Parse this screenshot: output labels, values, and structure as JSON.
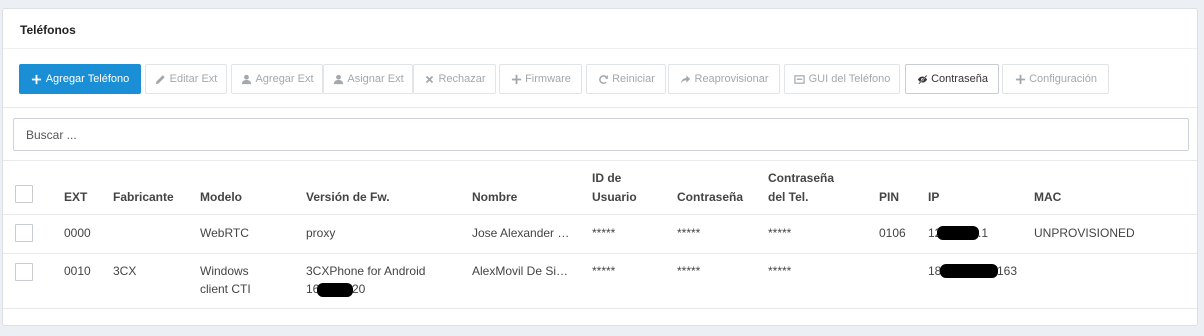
{
  "panel": {
    "title": "Teléfonos"
  },
  "toolbar": {
    "buttons": [
      {
        "label": "Agregar Teléfono",
        "icon": "plus-icon"
      },
      {
        "label": "Editar Ext",
        "icon": "pencil-icon"
      },
      {
        "label": "Agregar Ext",
        "icon": "user-icon"
      },
      {
        "label": "Asignar Ext",
        "icon": "user-icon"
      },
      {
        "label": "Rechazar",
        "icon": "x-icon"
      },
      {
        "label": "Firmware",
        "icon": "plus-icon"
      },
      {
        "label": "Reiniciar",
        "icon": "refresh-icon"
      },
      {
        "label": "Reaprovisionar",
        "icon": "share-arrow-icon"
      },
      {
        "label": "GUI del Teléfono",
        "icon": "window-icon"
      },
      {
        "label": "Contraseña",
        "icon": "eye-slash-icon"
      },
      {
        "label": "Configuración",
        "icon": "plus-icon"
      }
    ]
  },
  "search": {
    "placeholder": "Buscar ..."
  },
  "table": {
    "headers": {
      "ext": "EXT",
      "fabricante": "Fabricante",
      "modelo": "Modelo",
      "version": "Versión de Fw.",
      "nombre": "Nombre",
      "id_usuario_1": "ID de",
      "id_usuario_2": "Usuario",
      "contrasena": "Contraseña",
      "contrasena_tel_1": "Contraseña",
      "contrasena_tel_2": "del Tel.",
      "pin": "PIN",
      "ip": "IP",
      "mac": "MAC"
    },
    "rows": [
      {
        "ext": "0000",
        "fabricante": "",
        "modelo_1": "WebRTC",
        "modelo_2": "",
        "version_1": "proxy",
        "version_2": "",
        "nombre": "Jose Alexander Castaño",
        "id_usuario": "*****",
        "contrasena": "*****",
        "contrasena_tel": "*****",
        "pin": "0106",
        "ip_prefix": "12",
        "ip_suffix": ".1",
        "mac": "UNPROVISIONED"
      },
      {
        "ext": "0010",
        "fabricante": "3CX",
        "modelo_1": "Windows",
        "modelo_2": "client CTI",
        "version_1": "3CXPhone for Android",
        "version_2_prefix": "16",
        "version_2_suffix": "20",
        "nombre": "AlexMovil De Sistemas",
        "id_usuario": "*****",
        "contrasena": "*****",
        "contrasena_tel": "*****",
        "pin": "",
        "ip_prefix": "18",
        "ip_suffix": "163",
        "mac": ""
      }
    ]
  }
}
